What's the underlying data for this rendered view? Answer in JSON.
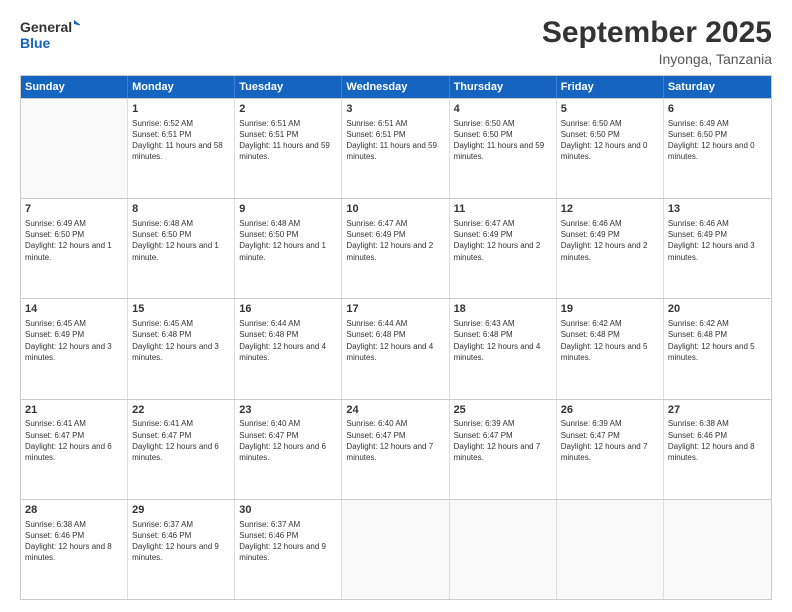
{
  "logo": {
    "line1": "General",
    "line2": "Blue"
  },
  "title": "September 2025",
  "subtitle": "Inyonga, Tanzania",
  "headers": [
    "Sunday",
    "Monday",
    "Tuesday",
    "Wednesday",
    "Thursday",
    "Friday",
    "Saturday"
  ],
  "weeks": [
    [
      {
        "day": "",
        "sunrise": "",
        "sunset": "",
        "daylight": ""
      },
      {
        "day": "1",
        "sunrise": "Sunrise: 6:52 AM",
        "sunset": "Sunset: 6:51 PM",
        "daylight": "Daylight: 11 hours and 58 minutes."
      },
      {
        "day": "2",
        "sunrise": "Sunrise: 6:51 AM",
        "sunset": "Sunset: 6:51 PM",
        "daylight": "Daylight: 11 hours and 59 minutes."
      },
      {
        "day": "3",
        "sunrise": "Sunrise: 6:51 AM",
        "sunset": "Sunset: 6:51 PM",
        "daylight": "Daylight: 11 hours and 59 minutes."
      },
      {
        "day": "4",
        "sunrise": "Sunrise: 6:50 AM",
        "sunset": "Sunset: 6:50 PM",
        "daylight": "Daylight: 11 hours and 59 minutes."
      },
      {
        "day": "5",
        "sunrise": "Sunrise: 6:50 AM",
        "sunset": "Sunset: 6:50 PM",
        "daylight": "Daylight: 12 hours and 0 minutes."
      },
      {
        "day": "6",
        "sunrise": "Sunrise: 6:49 AM",
        "sunset": "Sunset: 6:50 PM",
        "daylight": "Daylight: 12 hours and 0 minutes."
      }
    ],
    [
      {
        "day": "7",
        "sunrise": "Sunrise: 6:49 AM",
        "sunset": "Sunset: 6:50 PM",
        "daylight": "Daylight: 12 hours and 1 minute."
      },
      {
        "day": "8",
        "sunrise": "Sunrise: 6:48 AM",
        "sunset": "Sunset: 6:50 PM",
        "daylight": "Daylight: 12 hours and 1 minute."
      },
      {
        "day": "9",
        "sunrise": "Sunrise: 6:48 AM",
        "sunset": "Sunset: 6:50 PM",
        "daylight": "Daylight: 12 hours and 1 minute."
      },
      {
        "day": "10",
        "sunrise": "Sunrise: 6:47 AM",
        "sunset": "Sunset: 6:49 PM",
        "daylight": "Daylight: 12 hours and 2 minutes."
      },
      {
        "day": "11",
        "sunrise": "Sunrise: 6:47 AM",
        "sunset": "Sunset: 6:49 PM",
        "daylight": "Daylight: 12 hours and 2 minutes."
      },
      {
        "day": "12",
        "sunrise": "Sunrise: 6:46 AM",
        "sunset": "Sunset: 6:49 PM",
        "daylight": "Daylight: 12 hours and 2 minutes."
      },
      {
        "day": "13",
        "sunrise": "Sunrise: 6:46 AM",
        "sunset": "Sunset: 6:49 PM",
        "daylight": "Daylight: 12 hours and 3 minutes."
      }
    ],
    [
      {
        "day": "14",
        "sunrise": "Sunrise: 6:45 AM",
        "sunset": "Sunset: 6:49 PM",
        "daylight": "Daylight: 12 hours and 3 minutes."
      },
      {
        "day": "15",
        "sunrise": "Sunrise: 6:45 AM",
        "sunset": "Sunset: 6:48 PM",
        "daylight": "Daylight: 12 hours and 3 minutes."
      },
      {
        "day": "16",
        "sunrise": "Sunrise: 6:44 AM",
        "sunset": "Sunset: 6:48 PM",
        "daylight": "Daylight: 12 hours and 4 minutes."
      },
      {
        "day": "17",
        "sunrise": "Sunrise: 6:44 AM",
        "sunset": "Sunset: 6:48 PM",
        "daylight": "Daylight: 12 hours and 4 minutes."
      },
      {
        "day": "18",
        "sunrise": "Sunrise: 6:43 AM",
        "sunset": "Sunset: 6:48 PM",
        "daylight": "Daylight: 12 hours and 4 minutes."
      },
      {
        "day": "19",
        "sunrise": "Sunrise: 6:42 AM",
        "sunset": "Sunset: 6:48 PM",
        "daylight": "Daylight: 12 hours and 5 minutes."
      },
      {
        "day": "20",
        "sunrise": "Sunrise: 6:42 AM",
        "sunset": "Sunset: 6:48 PM",
        "daylight": "Daylight: 12 hours and 5 minutes."
      }
    ],
    [
      {
        "day": "21",
        "sunrise": "Sunrise: 6:41 AM",
        "sunset": "Sunset: 6:47 PM",
        "daylight": "Daylight: 12 hours and 6 minutes."
      },
      {
        "day": "22",
        "sunrise": "Sunrise: 6:41 AM",
        "sunset": "Sunset: 6:47 PM",
        "daylight": "Daylight: 12 hours and 6 minutes."
      },
      {
        "day": "23",
        "sunrise": "Sunrise: 6:40 AM",
        "sunset": "Sunset: 6:47 PM",
        "daylight": "Daylight: 12 hours and 6 minutes."
      },
      {
        "day": "24",
        "sunrise": "Sunrise: 6:40 AM",
        "sunset": "Sunset: 6:47 PM",
        "daylight": "Daylight: 12 hours and 7 minutes."
      },
      {
        "day": "25",
        "sunrise": "Sunrise: 6:39 AM",
        "sunset": "Sunset: 6:47 PM",
        "daylight": "Daylight: 12 hours and 7 minutes."
      },
      {
        "day": "26",
        "sunrise": "Sunrise: 6:39 AM",
        "sunset": "Sunset: 6:47 PM",
        "daylight": "Daylight: 12 hours and 7 minutes."
      },
      {
        "day": "27",
        "sunrise": "Sunrise: 6:38 AM",
        "sunset": "Sunset: 6:46 PM",
        "daylight": "Daylight: 12 hours and 8 minutes."
      }
    ],
    [
      {
        "day": "28",
        "sunrise": "Sunrise: 6:38 AM",
        "sunset": "Sunset: 6:46 PM",
        "daylight": "Daylight: 12 hours and 8 minutes."
      },
      {
        "day": "29",
        "sunrise": "Sunrise: 6:37 AM",
        "sunset": "Sunset: 6:46 PM",
        "daylight": "Daylight: 12 hours and 9 minutes."
      },
      {
        "day": "30",
        "sunrise": "Sunrise: 6:37 AM",
        "sunset": "Sunset: 6:46 PM",
        "daylight": "Daylight: 12 hours and 9 minutes."
      },
      {
        "day": "",
        "sunrise": "",
        "sunset": "",
        "daylight": ""
      },
      {
        "day": "",
        "sunrise": "",
        "sunset": "",
        "daylight": ""
      },
      {
        "day": "",
        "sunrise": "",
        "sunset": "",
        "daylight": ""
      },
      {
        "day": "",
        "sunrise": "",
        "sunset": "",
        "daylight": ""
      }
    ]
  ]
}
